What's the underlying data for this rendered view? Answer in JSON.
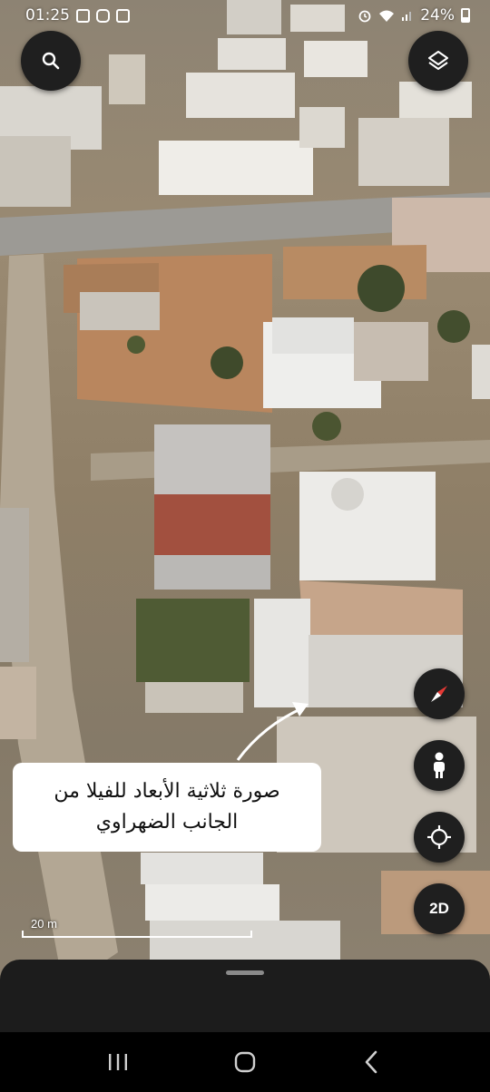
{
  "status_bar": {
    "time": "01:25",
    "battery": "24%",
    "icons": [
      "gallery-icon",
      "instagram-icon",
      "camera-app-icon",
      "alarm-icon",
      "wifi-icon",
      "signal-icon",
      "battery-icon"
    ]
  },
  "map": {
    "mode": "3D satellite",
    "scale_label": "20 m"
  },
  "controls": {
    "search_icon": "search-icon",
    "layers_icon": "layers-icon",
    "compass_icon": "compass-icon",
    "street_view_icon": "pegman-icon",
    "my_location_icon": "crosshair-icon",
    "toggle_2d_label": "2D"
  },
  "annotation": {
    "line1": "صورة ثلاثية الأبعاد للفيلا من",
    "line2": "الجانب الضهراوي"
  },
  "nav_bar": {
    "icons": [
      "recents-icon",
      "home-icon",
      "back-icon"
    ]
  },
  "colors": {
    "button_bg": "#1f1f1f",
    "compass_red": "#e53935",
    "sheet_bg": "#1c1c1c"
  }
}
